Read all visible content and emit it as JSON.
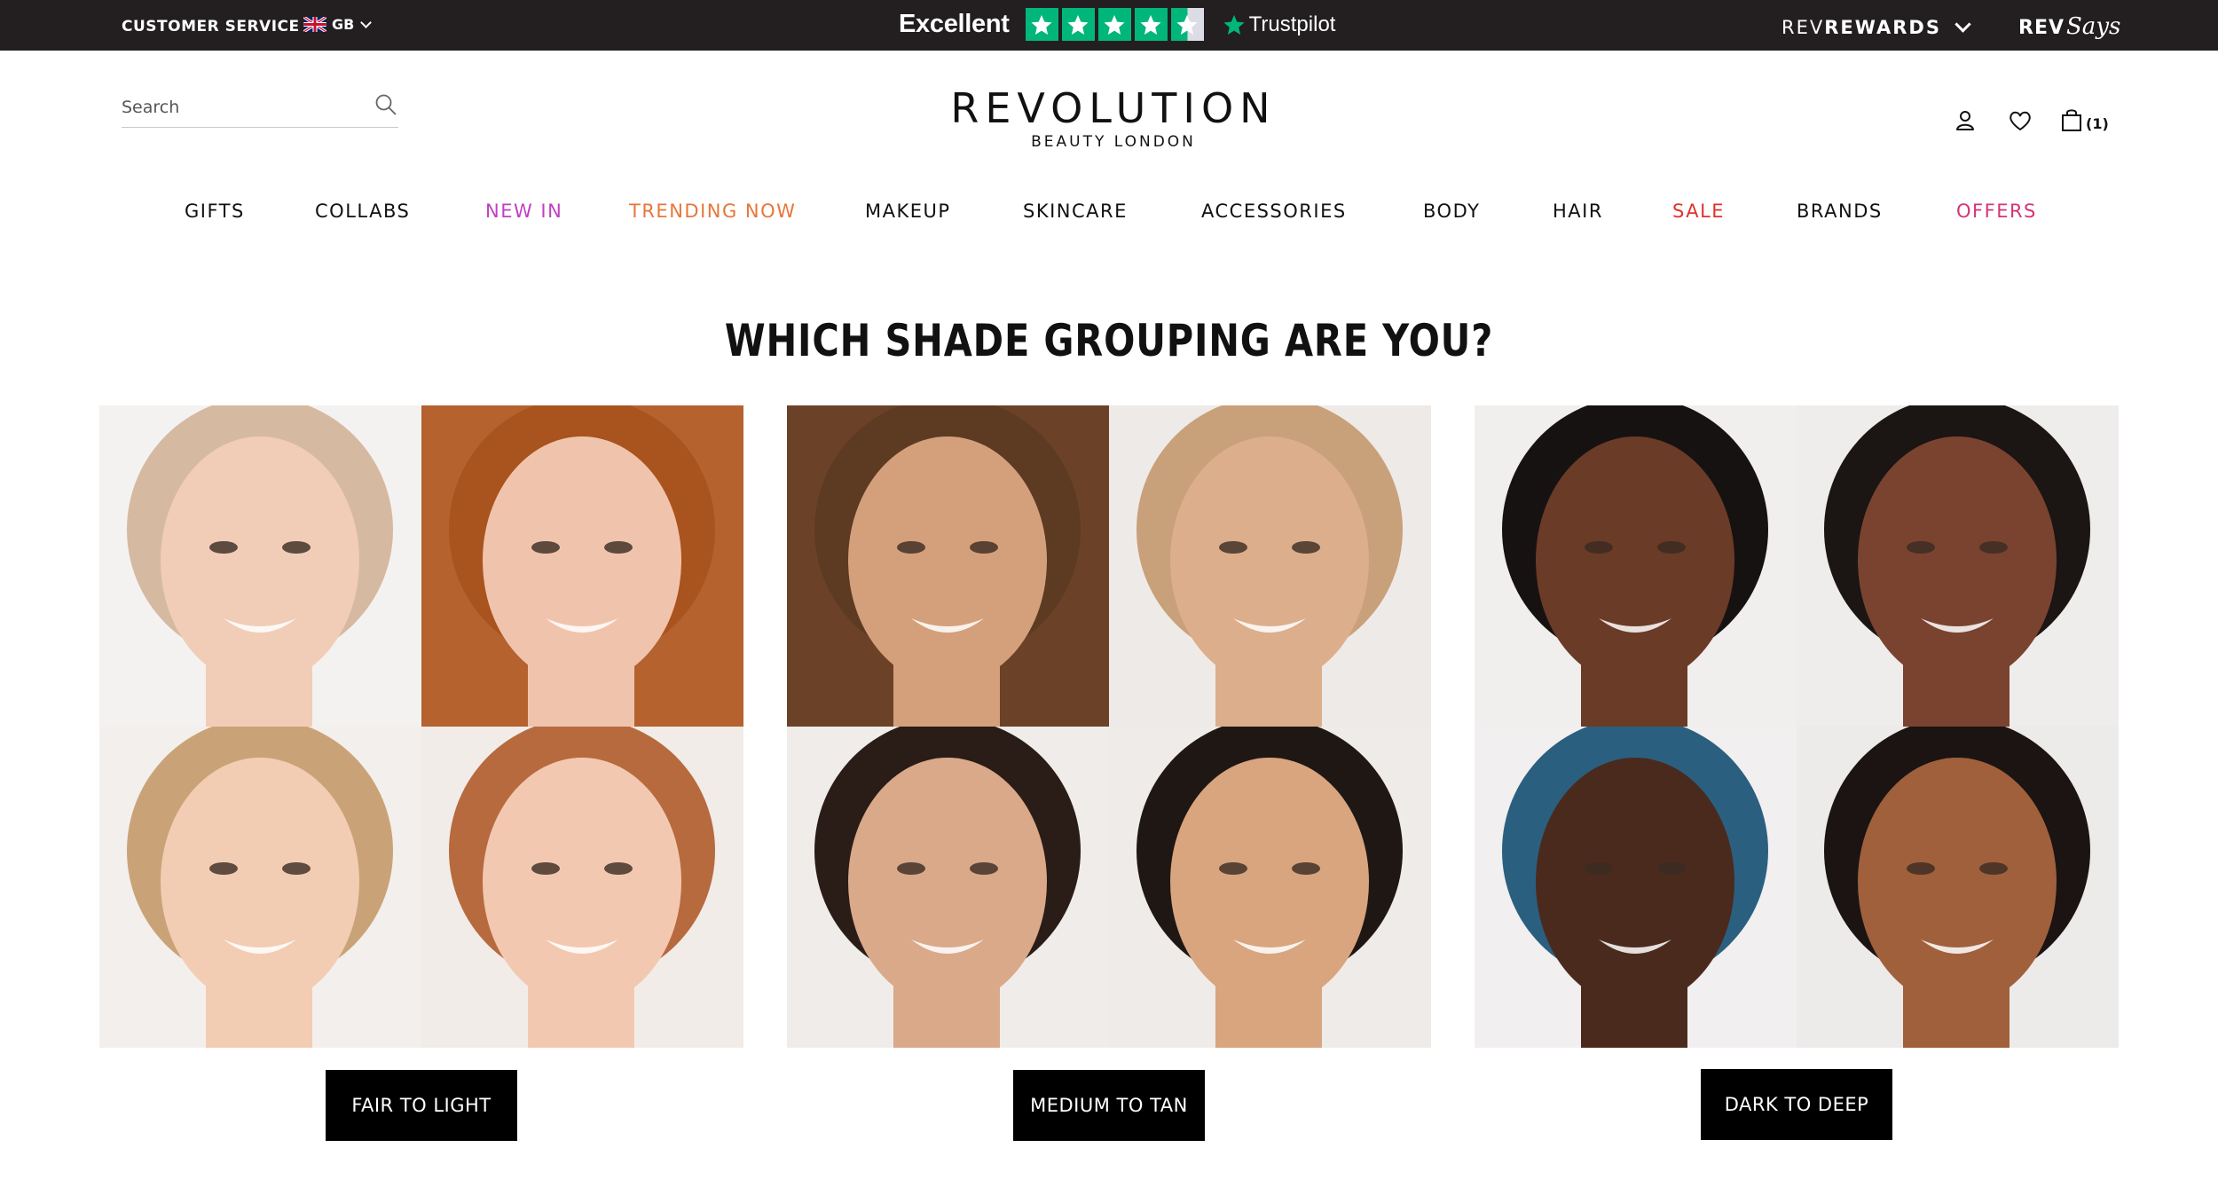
{
  "topbar": {
    "customer_service": "CUSTOMER SERVICE",
    "locale": "GB",
    "trustpilot_rating": "Excellent",
    "trustpilot_stars": 4.5,
    "trustpilot_brand": "Trustpilot",
    "rewards_prefix": "REV",
    "rewards_main": "REWARDS",
    "says_prefix": "REV",
    "says_main": "Says"
  },
  "header": {
    "search_placeholder": "Search",
    "logo_main": "REVOLUTION",
    "logo_sub": "BEAUTY LONDON",
    "bag_count": "(1)"
  },
  "nav": [
    {
      "label": "GIFTS",
      "color": "#111111"
    },
    {
      "label": "COLLABS",
      "color": "#111111"
    },
    {
      "label": "NEW IN",
      "color": "#c13fc4"
    },
    {
      "label": "TRENDING NOW",
      "color": "#e8763a"
    },
    {
      "label": "MAKEUP",
      "color": "#111111"
    },
    {
      "label": "SKINCARE",
      "color": "#111111"
    },
    {
      "label": "ACCESSORIES",
      "color": "#111111"
    },
    {
      "label": "BODY",
      "color": "#111111"
    },
    {
      "label": "HAIR",
      "color": "#111111"
    },
    {
      "label": "SALE",
      "color": "#e0322d"
    },
    {
      "label": "BRANDS",
      "color": "#111111"
    },
    {
      "label": "OFFERS",
      "color": "#d63479"
    }
  ],
  "main": {
    "heading": "WHICH SHADE GROUPING ARE YOU?",
    "groups": [
      {
        "button": "FAIR TO LIGHT",
        "tiles": [
          {
            "bg": "#f4f2f1",
            "skin": "#f1cdb8",
            "hair": "#d6b9a1"
          },
          {
            "bg": "#b5622f",
            "skin": "#f0c4ac",
            "hair": "#a9531f"
          },
          {
            "bg": "#f3efec",
            "skin": "#f2cdb3",
            "hair": "#c9a377"
          },
          {
            "bg": "#f1ece8",
            "skin": "#f3c8b1",
            "hair": "#b76a3e"
          }
        ]
      },
      {
        "button": "MEDIUM TO TAN",
        "tiles": [
          {
            "bg": "#6b4228",
            "skin": "#d4a07c",
            "hair": "#5d3a22"
          },
          {
            "bg": "#eeeae7",
            "skin": "#dcae8c",
            "hair": "#c8a07a"
          },
          {
            "bg": "#f0ece9",
            "skin": "#d9a98a",
            "hair": "#2a1c16"
          },
          {
            "bg": "#efebe8",
            "skin": "#d8a57f",
            "hair": "#1f1714"
          }
        ]
      },
      {
        "button": "DARK TO DEEP",
        "tiles": [
          {
            "bg": "#f1efee",
            "skin": "#6a3b26",
            "hair": "#171212"
          },
          {
            "bg": "#efedec",
            "skin": "#7a4330",
            "hair": "#1b1513"
          },
          {
            "bg": "#f1efef",
            "skin": "#4b2a1e",
            "hair": "#2b5f80"
          },
          {
            "bg": "#ecebea",
            "skin": "#a0603c",
            "hair": "#1b1412"
          }
        ]
      }
    ]
  }
}
